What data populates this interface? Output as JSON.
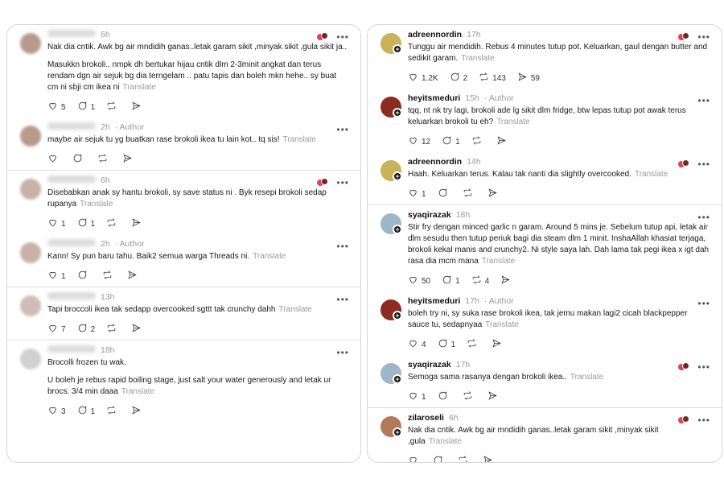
{
  "common": {
    "translate": "Translate",
    "author": "Author"
  },
  "left": {
    "threads": [
      {
        "posts": [
          {
            "user": "",
            "time": "6h",
            "author": false,
            "react": true,
            "paragraphs": [
              "Nak dia cntik. Awk bg air mndidih ganas..letak garam sikit ,minyak sikit ,gula sikit ja..",
              "Masukkn brokoli.. nmpk dh bertukar hijau cntik dlm 2-3minit angkat dan terus rendam dgn air sejuk bg dia terngelam .. patu tapis dan boleh mkn hehe.. sy buat cm ni sbji cm ikea ni"
            ],
            "likes": "5",
            "replies": "1",
            "reposts": "",
            "shares": ""
          },
          {
            "user": "",
            "time": "2h",
            "author": true,
            "react": false,
            "paragraphs": [
              "maybe air sejuk tu yg buatkan rase brokoli ikea tu lain kot.. tq sis!"
            ],
            "likes": "",
            "replies": "",
            "reposts": "",
            "shares": ""
          }
        ]
      },
      {
        "posts": [
          {
            "user": "",
            "time": "6h",
            "author": false,
            "react": true,
            "paragraphs": [
              "Disebabkan anak sy hantu brokoli, sy save status ni . Byk resepi brokoli sedap rupanya"
            ],
            "likes": "1",
            "replies": "1",
            "reposts": "",
            "shares": ""
          },
          {
            "user": "",
            "time": "2h",
            "author": true,
            "react": false,
            "paragraphs": [
              "Kann! Sy pun baru tahu. Baik2 semua warga Threads ni."
            ],
            "likes": "1",
            "replies": "",
            "reposts": "",
            "shares": ""
          }
        ]
      },
      {
        "posts": [
          {
            "user": "",
            "time": "13h",
            "author": false,
            "react": false,
            "paragraphs": [
              "Tapi broccoli ikea tak sedapp  overcooked sgttt tak crunchy dahh"
            ],
            "likes": "7",
            "replies": "2",
            "reposts": "",
            "shares": ""
          }
        ]
      },
      {
        "posts": [
          {
            "user": "",
            "time": "18h",
            "author": false,
            "react": false,
            "paragraphs": [
              "Brocolli frozen tu wak.",
              "U boleh je rebus rapid boiling stage, just salt your water generously and letak ur brocs. 3/4 min daaa"
            ],
            "likes": "3",
            "replies": "1",
            "reposts": "",
            "shares": ""
          }
        ]
      }
    ]
  },
  "right": {
    "threads": [
      {
        "posts": [
          {
            "user": "adreennordin",
            "time": "17h",
            "author": false,
            "react": true,
            "paragraphs": [
              "Tunggu air mendidih. Rebus 4 minutes tutup pot. Keluarkan, gaul dengan butter and sedikit garam."
            ],
            "likes": "1.2K",
            "replies": "2",
            "reposts": "143",
            "shares": "59"
          },
          {
            "user": "heyitsmeduri",
            "time": "15h",
            "author": true,
            "react": false,
            "paragraphs": [
              "tqq, nt nk try lagi, brokoli ade lg sikit dlm fridge, btw lepas tutup pot awak terus keluarkan brokoli tu eh?"
            ],
            "likes": "12",
            "replies": "1",
            "reposts": "",
            "shares": ""
          },
          {
            "user": "adreennordin",
            "time": "14h",
            "author": false,
            "react": true,
            "paragraphs": [
              "Haah. Keluarkan terus. Kalau tak nanti dia slightly overcooked."
            ],
            "likes": "1",
            "replies": "",
            "reposts": "",
            "shares": ""
          }
        ]
      },
      {
        "posts": [
          {
            "user": "syaqirazak",
            "time": "18h",
            "author": false,
            "react": false,
            "paragraphs": [
              "Stir fry dengan minced garlic n garam. Around 5 mins je. Sebelum tutup api, letak air dlm sesudu then tutup periuk bagi dia steam dlm 1 minit. InshaAllah khasiat terjaga, brokoli kekal manis and crunchy2. Ni style saya lah. Dah lama tak pegi ikea x igt dah rasa dia mcm mana"
            ],
            "likes": "50",
            "replies": "1",
            "reposts": "4",
            "shares": ""
          },
          {
            "user": "heyitsmeduri",
            "time": "17h",
            "author": true,
            "react": false,
            "paragraphs": [
              "boleh try ni, sy suka rase brokoli ikea, tak jemu makan lagi2 cicah blackpepper sauce tu, sedapnyaa"
            ],
            "likes": "4",
            "replies": "1",
            "reposts": "",
            "shares": ""
          },
          {
            "user": "syaqirazak",
            "time": "17h",
            "author": false,
            "react": true,
            "paragraphs": [
              "Semoga sama rasanya dengan brokoli ikea.."
            ],
            "likes": "1",
            "replies": "",
            "reposts": "",
            "shares": ""
          }
        ]
      },
      {
        "posts": [
          {
            "user": "zilaroseli",
            "time": "6h",
            "author": false,
            "react": true,
            "paragraphs": [
              "Nak dia cntik. Awk bg air mndidih ganas..letak garam sikit ,minyak sikit ,gula"
            ],
            "likes": "",
            "replies": "",
            "reposts": "",
            "shares": ""
          }
        ]
      }
    ]
  }
}
